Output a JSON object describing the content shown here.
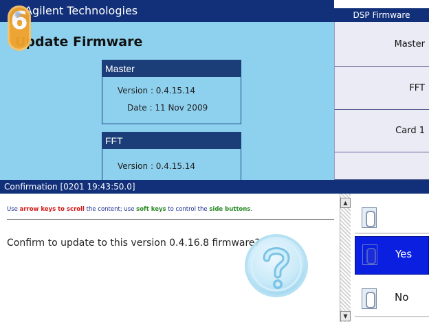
{
  "app": {
    "title": "Agilent Technologies",
    "side_panel_title": "DSP Firmware",
    "page_title": "Update Firmware",
    "page_title_visible": "Update Firmware"
  },
  "master": {
    "header": "Master",
    "version_label": "Version : 0.4.15.14",
    "date_label": "Date : 11 Nov 2009"
  },
  "fft": {
    "header": "FFT",
    "version_label": "Version : 0.4.15.14"
  },
  "side_buttons": [
    {
      "label": "Master"
    },
    {
      "label": "FFT"
    },
    {
      "label": "Card 1"
    },
    {
      "label": ""
    }
  ],
  "dialog": {
    "title": "Confirmation [0201 19:43:50.0]",
    "hint_parts": [
      {
        "text": "Use ",
        "style": "normal"
      },
      {
        "text": "arrow keys to scroll",
        "style": "red"
      },
      {
        "text": " the content; use ",
        "style": "normal"
      },
      {
        "text": "soft keys",
        "style": "green"
      },
      {
        "text": " to control the ",
        "style": "normal"
      },
      {
        "text": "side buttons",
        "style": "green"
      },
      {
        "text": ".",
        "style": "normal"
      }
    ],
    "question": "Confirm to update to this version 0.4.16.8 firmware?",
    "yes_label": "Yes",
    "no_label": "No"
  },
  "logo": {
    "glyph": "6"
  },
  "icons": {
    "help": "question-mark-icon",
    "scroll_up": "scroll-up-icon",
    "scroll_down": "scroll-down-icon"
  },
  "colors": {
    "title_bar": "#12307a",
    "panel_bg": "#8ed1ef",
    "selected_button": "#0a1fe0",
    "logo": "#f2a32a",
    "hint_red": "#d21818",
    "hint_green": "#2a8a25"
  }
}
